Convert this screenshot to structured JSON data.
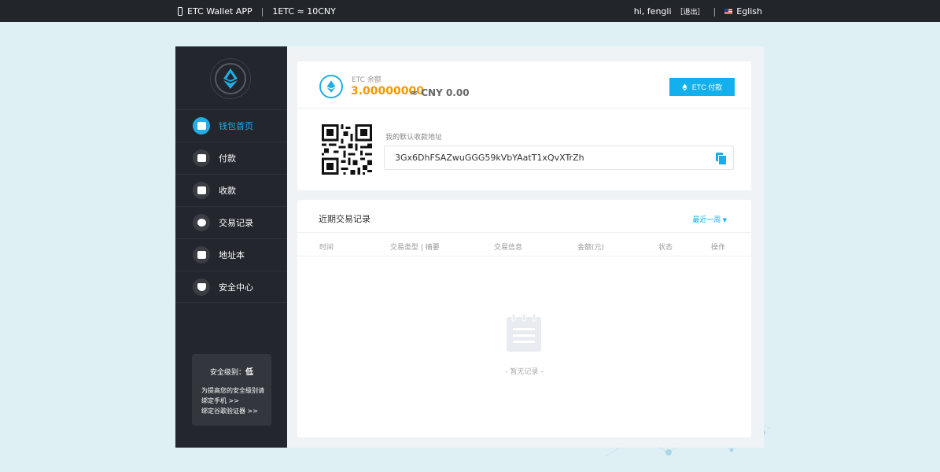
{
  "topbar": {
    "app_name": "ETC Wallet APP",
    "rate": "1ETC ≈ 10CNY",
    "greeting": "hi, fengli",
    "logout": "［退出］",
    "language": "Eglish"
  },
  "sidebar": {
    "items": [
      {
        "label": "钱包首页"
      },
      {
        "label": "付款"
      },
      {
        "label": "收款"
      },
      {
        "label": "交易记录"
      },
      {
        "label": "地址本"
      },
      {
        "label": "安全中心"
      }
    ],
    "security": {
      "level_label": "安全级别：",
      "level_value": "低",
      "tip": "为提高您的安全级别请",
      "bind_phone": "绑定手机 >>",
      "bind_google": "绑定谷歌验证器 >>"
    }
  },
  "balance": {
    "label": "ETC 余额",
    "amount": "3.00000000",
    "approx": "≈ CNY 0.00",
    "pay_button": "ETC 付款",
    "address_label": "我的默认收款地址",
    "address": "3Gx6DhFSAZwuGGG59kVbYAatT1xQvXTrZh"
  },
  "records": {
    "title": "近期交易记录",
    "filter": "最近一周",
    "columns": [
      "时间",
      "交易类型 | 摘要",
      "交易信息",
      "金额(元)",
      "状态",
      "操作"
    ],
    "empty_text": "- 暂无记录 -"
  },
  "colors": {
    "accent": "#12b0ec",
    "balance": "#f39800",
    "sidebar_bg": "#23262c",
    "topbar_bg": "#22252a"
  }
}
